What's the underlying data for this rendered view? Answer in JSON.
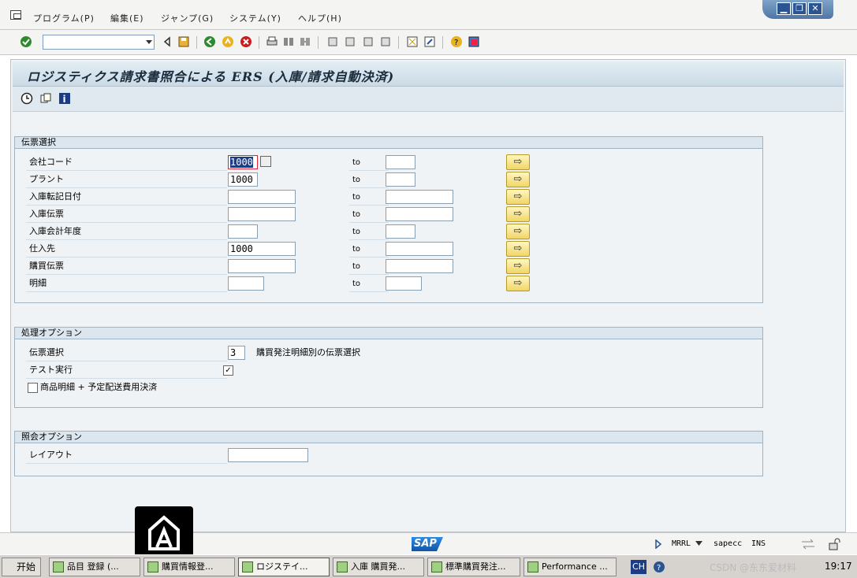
{
  "menu": {
    "items": [
      "プログラム(P)",
      "編集(E)",
      "ジャンプ(G)",
      "システム(Y)",
      "ヘルプ(H)"
    ]
  },
  "window_controls": {
    "minimize": "▁",
    "restore": "❐",
    "close": "✕"
  },
  "command_field": {
    "value": ""
  },
  "page": {
    "title": "ロジスティクス請求書照合による ERS (入庫/請求自動決済)"
  },
  "doc_selection": {
    "title": "伝票選択",
    "to_label": "to",
    "rows": [
      {
        "label": "会社コード",
        "from": "1000",
        "to": ""
      },
      {
        "label": "プラント",
        "from": "1000",
        "to": ""
      },
      {
        "label": "入庫転記日付",
        "from": "",
        "to": ""
      },
      {
        "label": "入庫伝票",
        "from": "",
        "to": ""
      },
      {
        "label": "入庫会計年度",
        "from": "",
        "to": ""
      },
      {
        "label": "仕入先",
        "from": "1000",
        "to": ""
      },
      {
        "label": "購買伝票",
        "from": "",
        "to": ""
      },
      {
        "label": "明細",
        "from": "",
        "to": ""
      }
    ],
    "multi_arrow": "⇨"
  },
  "processing": {
    "title": "処理オプション",
    "doc_select_label": "伝票選択",
    "doc_select_value": "3",
    "doc_select_desc": "購買発注明細別の伝票選択",
    "test_run_label": "テスト実行",
    "test_run_checked": "✓",
    "item_plus_label": "商品明細 + 予定配送費用決済"
  },
  "display": {
    "title": "照会オプション",
    "layout_label": "レイアウト",
    "layout_value": ""
  },
  "status": {
    "logo": "SAP",
    "transaction": "MRRL",
    "server": "sapecc",
    "mode": "INS"
  },
  "taskbar": {
    "start": "开始",
    "tasks": [
      "品目 登録 (...",
      "購買情報登...",
      "ロジステイ...",
      "入庫 購買発...",
      "標準購買発注...",
      "Performance ..."
    ],
    "lang": "CH",
    "watermark": "CSDN @东东爱材料",
    "clock": "19:17"
  },
  "colors": {
    "accent_blue": "#1c3d84",
    "button_yellow": "#f1d565",
    "title_bar": "#cbdbe6"
  }
}
